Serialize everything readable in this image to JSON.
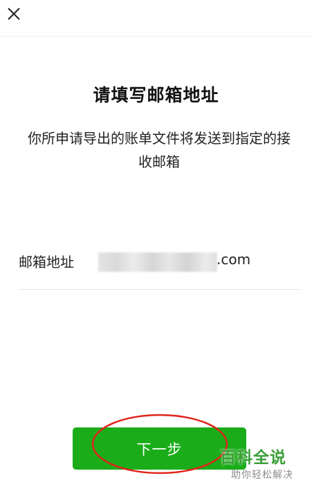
{
  "header": {
    "close_icon": "close-icon"
  },
  "main": {
    "title": "请填写邮箱地址",
    "description": "你所申请导出的账单文件将发送到指定的接收邮箱"
  },
  "form": {
    "email_label": "邮箱地址",
    "email_value_visible_suffix": ".com",
    "email_value_redacted": true
  },
  "actions": {
    "next_label": "下一步",
    "next_color": "#1aad19"
  },
  "annotation": {
    "color": "#e0231b"
  },
  "watermark": {
    "main": "百科全说",
    "sub": "助你轻松解决",
    "color": "#3a9f36"
  }
}
